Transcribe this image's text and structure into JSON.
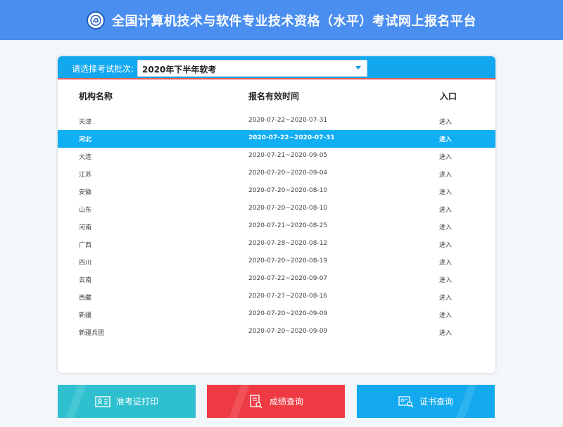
{
  "header": {
    "title": "全国计算机技术与软件专业技术资格（水平）考试网上报名平台"
  },
  "batch": {
    "label": "请选择考试批次:",
    "selected": "2020年下半年软考"
  },
  "table": {
    "headers": [
      "机构名称",
      "报名有效时间",
      "入口"
    ],
    "rows": [
      {
        "name": "天津",
        "period": "2020-07-22~2020-07-31",
        "entry": "进入"
      },
      {
        "name": "河北",
        "period": "2020-07-22~2020-07-31",
        "entry": "进入"
      },
      {
        "name": "大连",
        "period": "2020-07-21~2020-09-05",
        "entry": "进入"
      },
      {
        "name": "江苏",
        "period": "2020-07-20~2020-09-04",
        "entry": "进入"
      },
      {
        "name": "安徽",
        "period": "2020-07-20~2020-08-10",
        "entry": "进入"
      },
      {
        "name": "山东",
        "period": "2020-07-20~2020-08-10",
        "entry": "进入"
      },
      {
        "name": "河南",
        "period": "2020-07-21~2020-08-25",
        "entry": "进入"
      },
      {
        "name": "广西",
        "period": "2020-07-28~2020-08-12",
        "entry": "进入"
      },
      {
        "name": "四川",
        "period": "2020-07-20~2020-08-19",
        "entry": "进入"
      },
      {
        "name": "云南",
        "period": "2020-07-22~2020-09-07",
        "entry": "进入"
      },
      {
        "name": "西藏",
        "period": "2020-07-27~2020-08-16",
        "entry": "进入"
      },
      {
        "name": "新疆",
        "period": "2020-07-20~2020-09-09",
        "entry": "进入"
      },
      {
        "name": "新疆兵团",
        "period": "2020-07-20~2020-09-09",
        "entry": "进入"
      }
    ],
    "selected_row": "河北"
  },
  "buttons": {
    "print": {
      "label": "准考证打印",
      "icon": "id-card-icon"
    },
    "score": {
      "label": "成绩查询",
      "icon": "document-search-icon"
    },
    "cert": {
      "label": "证书查询",
      "icon": "certificate-search-icon"
    }
  },
  "colors": {
    "header": "#4a8ef0",
    "accent": "#12a7ef",
    "print_button": "#2ec0cf",
    "score_button": "#ee3a43",
    "cert_button": "#12a9ee"
  }
}
